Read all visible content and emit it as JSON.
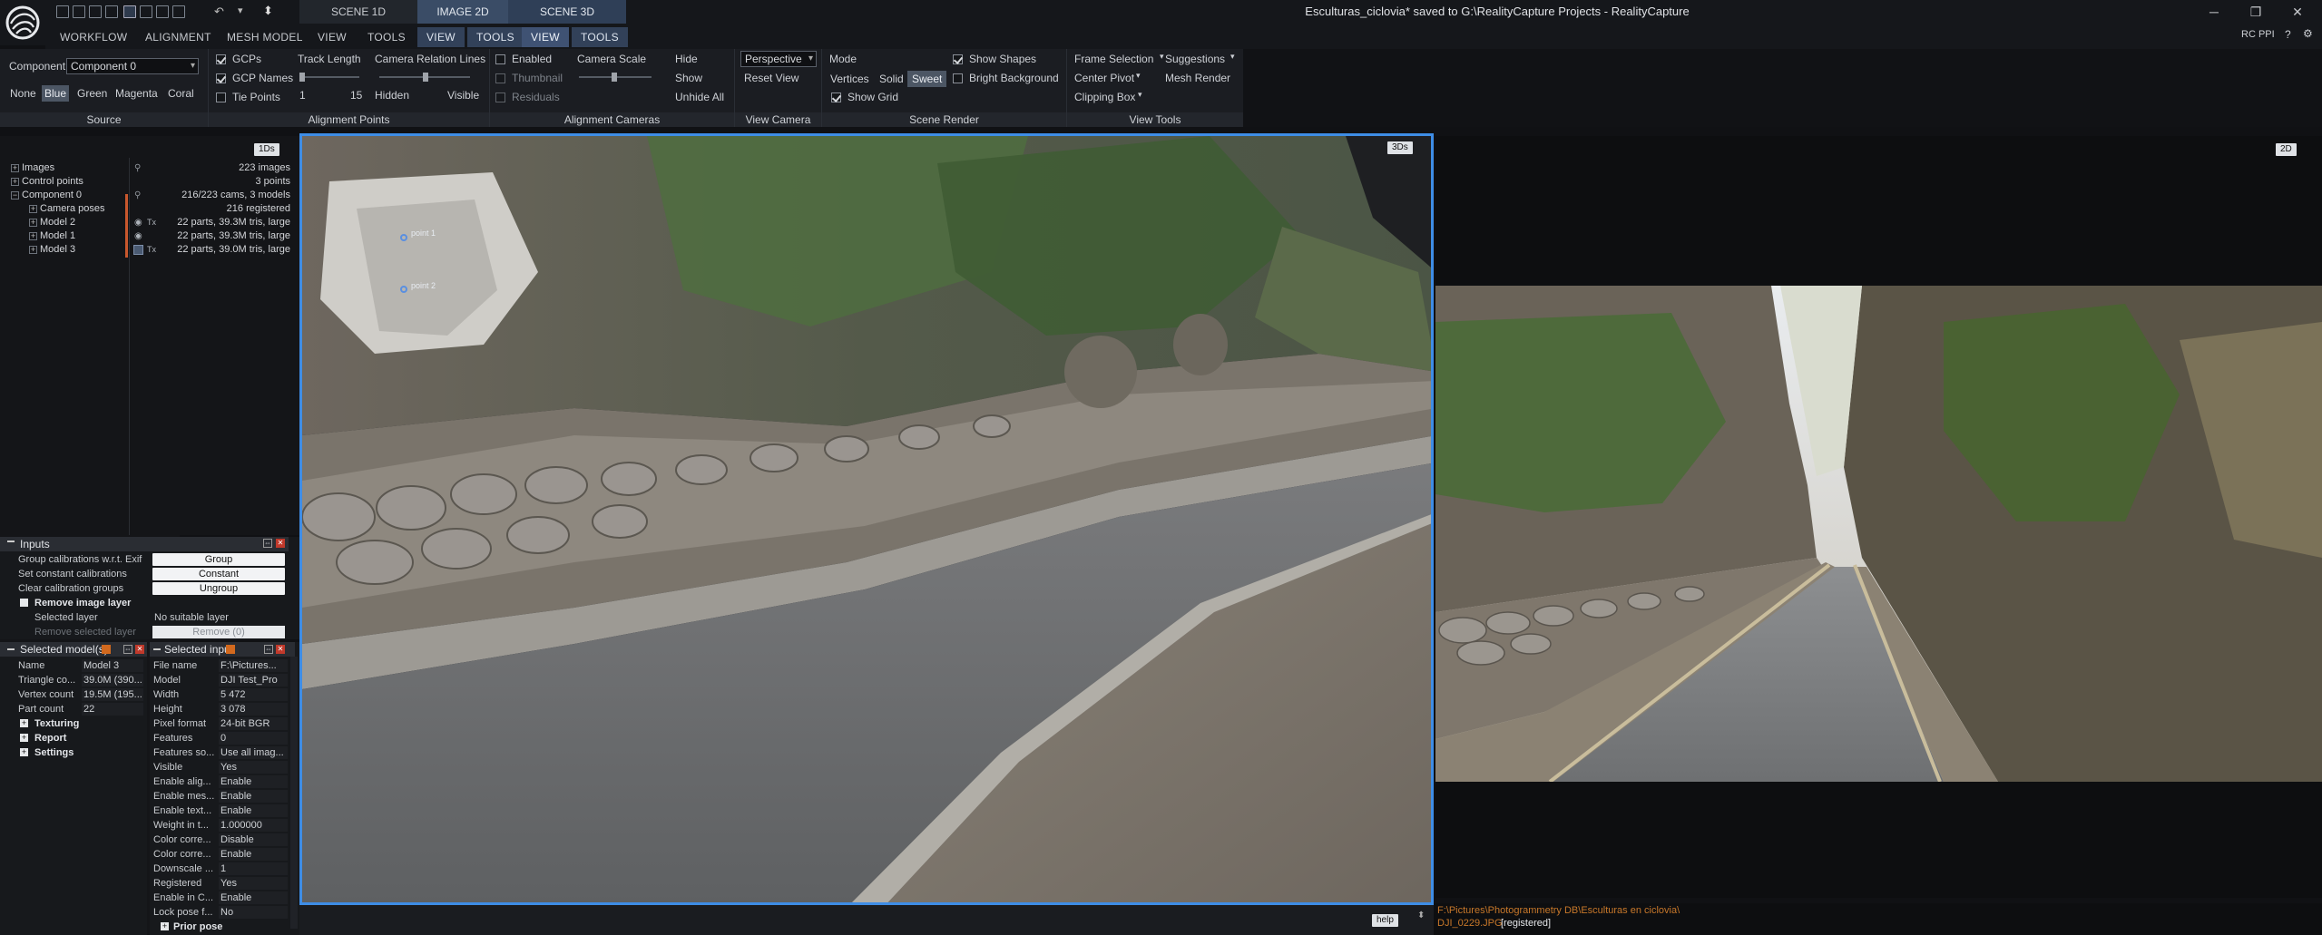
{
  "window": {
    "title": "Esculturas_ciclovia* saved to G:\\RealityCapture Projects - RealityCapture",
    "minimize": "─",
    "restore": "❐",
    "close": "✕"
  },
  "layout_tabs": {
    "scene1d": "SCENE 1D",
    "image2d": "IMAGE 2D",
    "scene3d": "SCENE 3D"
  },
  "menu": {
    "items": [
      "WORKFLOW",
      "ALIGNMENT",
      "MESH MODEL",
      "VIEW",
      "TOOLS",
      "VIEW",
      "TOOLS",
      "VIEW",
      "TOOLS"
    ],
    "user": "RC PPI"
  },
  "ribbon": {
    "source": {
      "label": "Source",
      "component_label": "Component",
      "component_value": "Component 0",
      "colors": [
        "None",
        "Blue",
        "Green",
        "Magenta",
        "Coral"
      ]
    },
    "alignment_points": {
      "label": "Alignment Points",
      "gcps": "GCPs",
      "gcp_names": "GCP Names",
      "tie_points": "Tie Points",
      "track_length": "Track Length",
      "track_min": "1",
      "track_max": "15",
      "camera_relation_lines": "Camera Relation Lines",
      "hidden": "Hidden",
      "visible": "Visible"
    },
    "alignment_cameras": {
      "label": "Alignment Cameras",
      "enabled": "Enabled",
      "thumbnail": "Thumbnail",
      "residuals": "Residuals",
      "camera_scale": "Camera Scale",
      "hide": "Hide",
      "show": "Show",
      "unhide_all": "Unhide All"
    },
    "view_camera": {
      "label": "View Camera",
      "projection": "Perspective",
      "reset_view": "Reset View"
    },
    "scene_render": {
      "label": "Scene Render",
      "mode": "Mode",
      "vertices": "Vertices",
      "solid": "Solid",
      "sweet": "Sweet",
      "show_grid": "Show Grid",
      "show_shapes": "Show Shapes",
      "bright_background": "Bright Background"
    },
    "view_tools": {
      "label": "View Tools",
      "frame_selection": "Frame Selection",
      "suggestions": "Suggestions",
      "center_pivot": "Center Pivot",
      "mesh_render": "Mesh Render",
      "clipping_box": "Clipping Box"
    }
  },
  "tree": {
    "badge": "1Ds",
    "rows": [
      {
        "label": "Images",
        "value": "223 images"
      },
      {
        "label": "Control points",
        "value": "3 points"
      },
      {
        "label": "Component 0",
        "value": "216/223 cams, 3 models"
      },
      {
        "label": "Camera poses",
        "value": "216 registered"
      },
      {
        "label": "Model 2",
        "value": "22 parts, 39.3M tris, large"
      },
      {
        "label": "Model 1",
        "value": "22 parts, 39.3M tris, large"
      },
      {
        "label": "Model 3",
        "value": "22 parts, 39.0M tris, large"
      }
    ]
  },
  "inputs_panel": {
    "title": "Inputs",
    "rows": [
      {
        "label": "Group calibrations w.r.t. Exif",
        "button": "Group"
      },
      {
        "label": "Set constant calibrations",
        "button": "Constant"
      },
      {
        "label": "Clear calibration groups",
        "button": "Ungroup"
      }
    ],
    "remove_section": "Remove image layer",
    "selected_layer": "Selected layer",
    "selected_layer_value": "No suitable layer",
    "remove_selected": "Remove selected layer",
    "remove_button": "Remove (0)"
  },
  "selected_models": {
    "title": "Selected model(s)",
    "rows": [
      {
        "label": "Name",
        "value": "Model 3"
      },
      {
        "label": "Triangle co...",
        "value": "39.0M (390..."
      },
      {
        "label": "Vertex count",
        "value": "19.5M (195..."
      },
      {
        "label": "Part count",
        "value": "22"
      }
    ],
    "sections": [
      "Texturing",
      "Report",
      "Settings"
    ]
  },
  "selected_input": {
    "title": "Selected input",
    "rows": [
      {
        "label": "File name",
        "value": "F:\\Pictures..."
      },
      {
        "label": "Model",
        "value": "DJI Test_Pro"
      },
      {
        "label": "Width",
        "value": "5 472"
      },
      {
        "label": "Height",
        "value": "3 078"
      },
      {
        "label": "Pixel format",
        "value": "24-bit BGR"
      },
      {
        "label": "Features",
        "value": "0"
      },
      {
        "label": "Features so...",
        "value": "Use all imag..."
      },
      {
        "label": "Visible",
        "value": "Yes"
      },
      {
        "label": "Enable alig...",
        "value": "Enable"
      },
      {
        "label": "Enable mes...",
        "value": "Enable"
      },
      {
        "label": "Enable text...",
        "value": "Enable"
      },
      {
        "label": "Weight in t...",
        "value": "1.000000"
      },
      {
        "label": "Color corre...",
        "value": "Disable"
      },
      {
        "label": "Color corre...",
        "value": "Enable"
      },
      {
        "label": "Downscale ...",
        "value": "1"
      },
      {
        "label": "Registered",
        "value": "Yes"
      },
      {
        "label": "Enable in C...",
        "value": "Enable"
      },
      {
        "label": "Lock pose f...",
        "value": "No"
      }
    ],
    "section": "Prior pose"
  },
  "view3d": {
    "tag": "3Ds",
    "gcp1": "point 1",
    "gcp2": "point 2",
    "help": "help"
  },
  "view2d": {
    "tag": "2D"
  },
  "status": {
    "path": "F:\\Pictures\\Photogrammetry DB\\Esculturas en ciclovia\\",
    "file": "DJI_0229.JPG",
    "state": "[registered]"
  },
  "colors": {
    "accent": "#3e8de6",
    "status_path": "#c8782a"
  }
}
